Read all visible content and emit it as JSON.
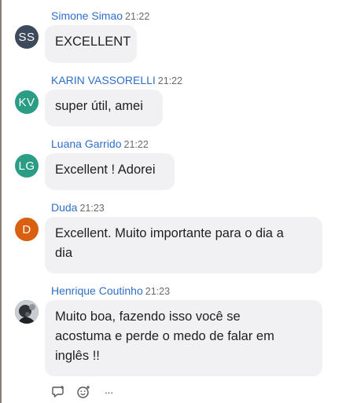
{
  "messages": [
    {
      "author": "Simone Simao",
      "initials": "SS",
      "avatar_color": "#3d4a5c",
      "time": "21:22",
      "lines": [
        "EXCELLENT"
      ]
    },
    {
      "author": "KARIN VASSORELLI",
      "initials": "KV",
      "avatar_color": "#2a9d84",
      "time": "21:22",
      "lines": [
        "super útil, amei"
      ]
    },
    {
      "author": "Luana Garrido",
      "initials": "LG",
      "avatar_color": "#2a9d84",
      "time": "21:22",
      "lines": [
        "Excellent ! Adorei"
      ]
    },
    {
      "author": "Duda",
      "initials": "D",
      "avatar_color": "#d9600f",
      "time": "21:23",
      "lines": [
        "Excellent. Muito importante para o dia a",
        "dia"
      ]
    },
    {
      "author": "Henrique Coutinho",
      "initials": "",
      "avatar_color": "#4a4f55",
      "time": "21:23",
      "lines": [
        "Muito boa, fazendo isso você se",
        "acostuma e perde o medo de falar em",
        "inglês !!"
      ]
    }
  ],
  "actions": {
    "reply_icon": "reply-icon",
    "react_icon": "emoji-react-icon",
    "more_icon": "more-options-icon",
    "more_glyph": "···"
  }
}
